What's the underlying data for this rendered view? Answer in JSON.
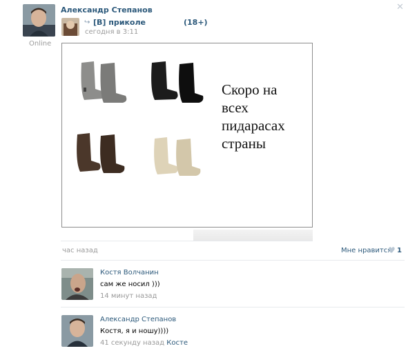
{
  "post": {
    "author": "Александр Степанов",
    "status": "Online",
    "close_symbol": "✕",
    "repost_icon": "repost-arrow-icon",
    "group_name": "[В] приколе",
    "age_tag": "(18+)",
    "time": "сегодня в 3:11",
    "image_caption": "Скоро на всех пидарасах страны",
    "posted_ago": "час назад",
    "like_label": "Мне нравится",
    "like_count": "1"
  },
  "comments": [
    {
      "name": "Костя Волчанин",
      "text": "сам же носил )))",
      "time": "14 минут назад",
      "reply_to": ""
    },
    {
      "name": "Александр Степанов",
      "text": "Костя, я и ношу))))",
      "time": "41 секунду назад",
      "reply_to": "Косте"
    }
  ],
  "colors": {
    "link": "#2b587a",
    "meta": "#999999",
    "separator": "#e7eaed",
    "heart": "#b8c6d3"
  }
}
